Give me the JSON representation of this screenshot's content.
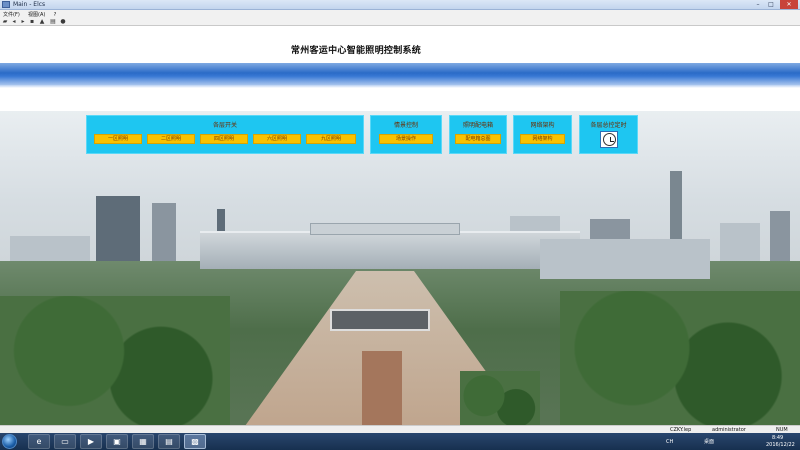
{
  "window": {
    "title": "Main - Elcs",
    "min": "–",
    "max": "□",
    "close": "✕"
  },
  "menu": [
    "文件(F)",
    "视图(A)",
    "?"
  ],
  "toolbar_icons": [
    "open-icon",
    "back-icon",
    "forward-icon",
    "save-icon",
    "alarm-icon",
    "print-icon",
    "help-icon"
  ],
  "system_title": "常州客运中心智能照明控制系统",
  "panels": {
    "floor_lighting": {
      "title": "各层开关",
      "buttons": [
        "一区照明",
        "二区照明",
        "四区照明",
        "六区照明",
        "九区照明"
      ]
    },
    "scene_control": {
      "title": "情景控制",
      "button": "场景操作"
    },
    "distribution_box": {
      "title": "照明配电箱",
      "button": "配电箱总图"
    },
    "network": {
      "title": "网络架构",
      "button": "网络架构"
    },
    "timer": {
      "title": "各层总控定时"
    }
  },
  "status": {
    "file": "CZKY.lep",
    "user": "administrator",
    "mode": "NUM"
  },
  "taskbar": {
    "time": "8:49",
    "date": "2016/12/22",
    "lang": "CH",
    "desktop": "桌面"
  },
  "colors": {
    "panel": "#1ec6f1",
    "button": "#f9c200",
    "band": "#2b6bc7"
  }
}
